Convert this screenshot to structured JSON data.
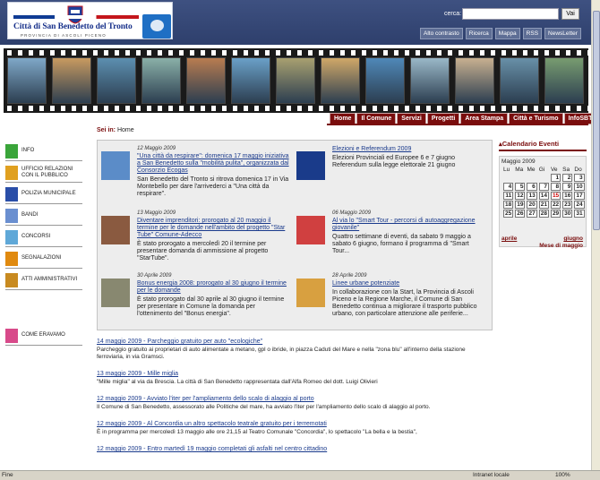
{
  "header": {
    "logo_title": "Città di San Benedetto del Tronto",
    "logo_subtitle": "PROVINCIA DI ASCOLI PICENO",
    "search_label": "cerca:",
    "search_value": "",
    "search_button": "Vai",
    "tools": [
      "Alto contrasto",
      "Ricerca",
      "Mappa",
      "RSS",
      "NewsLetter"
    ]
  },
  "tabs": [
    "Home",
    "Il Comune",
    "Servizi",
    "Progetti",
    "Area Stampa",
    "Città e Turismo",
    "InfoSBT"
  ],
  "breadcrumb": {
    "label": "Sei in:",
    "current": "Home"
  },
  "sidenav": [
    {
      "label": "Info",
      "icon": "info-icon",
      "color": "#3aa53a"
    },
    {
      "label": "Ufficio relazioni con il pubblico",
      "icon": "urp-icon",
      "color": "#e0a020"
    },
    {
      "label": "Polizia municipale",
      "icon": "police-icon",
      "color": "#2a4ea8"
    },
    {
      "label": "Bandi",
      "icon": "document-icon",
      "color": "#6a8fd0"
    },
    {
      "label": "Concorsi",
      "icon": "competition-icon",
      "color": "#5fa8d8"
    },
    {
      "label": "Segnalazioni",
      "icon": "alert-icon",
      "color": "#e08a10"
    },
    {
      "label": "Atti amministrativi",
      "icon": "acts-icon",
      "color": "#c88a20"
    },
    {
      "label": "Come eravamo",
      "icon": "history-icon",
      "color": "#d84a8a"
    }
  ],
  "news": [
    {
      "date": "12 Maggio 2009",
      "title": "\"Una città da respirare\": domenica 17 maggio iniziativa a San Benedetto sulla \"mobilità pulita\", organizzata dal Consorzio Ecogas",
      "text": "San Benedetto del Tronto si ritrova domenica 17 in Via Montebello per dare l'arrivederci a \"Una città da respirare\"."
    },
    {
      "date": "",
      "title": "Elezioni e Referendum 2009",
      "text": "Elezioni Provinciali ed Europee 6 e 7 giugno Referendum sulla legge elettorale 21 giugno"
    },
    {
      "date": "13 Maggio 2009",
      "title": "Diventare imprenditori: prorogato al 20 maggio il termine per le domande nell'ambito del progetto \"Star Tube\" Comune-Adecco",
      "text": "È stato prorogato a mercoledì 20 il termine per presentare domanda di ammissione al progetto \"StarTube\"."
    },
    {
      "date": "06 Maggio 2009",
      "title": "Al via lo \"Smart Tour - percorsi di autoaggregazione giovanile\"",
      "text": "Quattro settimane di eventi, da sabato 9 maggio a sabato 6 giugno, formano il programma di \"Smart Tour..."
    },
    {
      "date": "30 Aprile 2009",
      "title": "Bonus energia 2008: prorogato al 30 giugno il termine per le domande",
      "text": "È stato prorogato dal 30 aprile al 30 giugno il termine per presentare in Comune la domanda per l'ottenimento del \"Bonus energia\"."
    },
    {
      "date": "28 Aprile 2009",
      "title": "Linee urbane potenziate",
      "text": "In collaborazione con la Start, la Provincia di Ascoli Piceno e la Regione Marche, il Comune di San Benedetto continua a migliorare il trasporto pubblico urbano, con particolare attenzione alle periferie..."
    }
  ],
  "calendar": {
    "heading": "Calendario Eventi",
    "month": "Maggio 2009",
    "days": [
      "Lu",
      "Ma",
      "Me",
      "Gi",
      "Ve",
      "Sa",
      "Do"
    ],
    "weeks": [
      [
        "",
        "",
        "",
        "",
        "1",
        "2",
        "3"
      ],
      [
        "4",
        "5",
        "6",
        "7",
        "8",
        "9",
        "10"
      ],
      [
        "11",
        "12",
        "13",
        "14",
        "15",
        "16",
        "17"
      ],
      [
        "18",
        "19",
        "20",
        "21",
        "22",
        "23",
        "24"
      ],
      [
        "25",
        "26",
        "27",
        "28",
        "29",
        "30",
        "31"
      ]
    ],
    "today": "15",
    "prev": "aprile",
    "next": "giugno",
    "month_link": "Mese di maggio"
  },
  "list": [
    {
      "title": "14 maggio 2009 - Parcheggio gratuito per auto \"ecologiche\"",
      "text": "Parcheggio gratuito ai proprietari di auto alimentate a metano, gpl o ibride, in piazza Caduti del Mare e nella \"zona blu\" all'interno della stazione ferroviaria, in via Gramsci."
    },
    {
      "title": "13 maggio 2009 - Mille miglia",
      "text": "\"Mille miglia\" al via da Brescia. La città di San Benedetto rappresentata dall'Alfa Romeo del dott. Luigi Olivieri"
    },
    {
      "title": "12 maggio 2009 - Avviato l'iter per l'ampliamento dello scalo di alaggio al porto",
      "text": "Il Comune di San Benedetto, assessorato alle Politiche del mare, ha avviato l'iter per l'ampliamento dello scalo di alaggio al porto."
    },
    {
      "title": "12 maggio 2009 - Al Concordia un altro spettacolo teatrale gratuito per i terremotati",
      "text": "È in programma per mercoledì 13 maggio alle ore 21,15 al Teatro Comunale \"Concordia\", lo spettacolo \"La bella e la bestia\","
    },
    {
      "title": "12 maggio 2009 - Entro martedì 19 maggio completati gli asfalti nel centro cittadino",
      "text": ""
    }
  ],
  "status": {
    "left": "Fine",
    "zone": "Intranet locale",
    "zoom": "100%"
  }
}
